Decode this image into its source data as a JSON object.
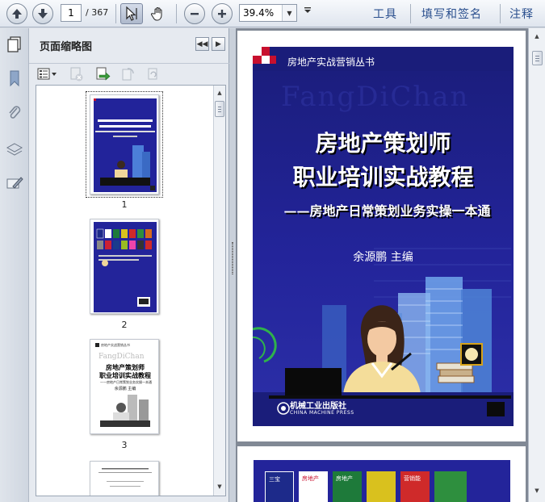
{
  "toolbar": {
    "current_page": "1",
    "total_pages": "/ 367",
    "zoom": "39.4%",
    "menu": [
      "工具",
      "填写和签名",
      "注释"
    ]
  },
  "panel": {
    "title": "页面缩略图",
    "thumbnails": [
      {
        "number": "1",
        "selected": true
      },
      {
        "number": "2",
        "selected": false
      },
      {
        "number": "3",
        "selected": false
      }
    ],
    "thumb3": {
      "series": "房地产实战营销丛书",
      "watermark": "FangDiChan",
      "title_line1": "房地产策划师",
      "title_line2": "职业培训实战教程",
      "subtitle": "——房地产日常策划业务实操一本通",
      "author": "余源鹏  主编"
    }
  },
  "cover": {
    "series": "房地产实战营销丛书",
    "watermark": "FangDiChan",
    "title_line1": "房地产策划师",
    "title_line2": "职业培训实战教程",
    "subtitle": "——房地产日常策划业务实操一本通",
    "author": "余源鹏  主编",
    "publisher": "机械工业出版社",
    "publisher_en": "CHINA MACHINE PRESS"
  },
  "page2_strip": {
    "books": [
      "三宝",
      "房地产",
      "房地产",
      "",
      "营销能"
    ],
    "book_colors": [
      "#1d2a8a",
      "#ffffff",
      "#1e7a3a",
      "#d9c11e",
      "#cf2a2a",
      "#2e8f3e"
    ]
  },
  "colors": {
    "accent_link": "#2a4f8e",
    "cover_blue": "#23249a",
    "cover_red": "#c8102e"
  }
}
